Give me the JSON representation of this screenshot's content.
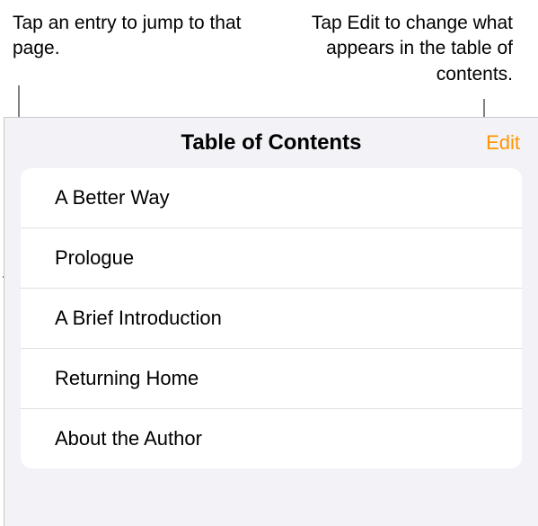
{
  "callouts": {
    "left": "Tap an entry to jump to that page.",
    "right": "Tap Edit to change what appears in the table of contents."
  },
  "panel": {
    "title": "Table of Contents",
    "editLabel": "Edit"
  },
  "toc": {
    "items": [
      {
        "label": "A Better Way"
      },
      {
        "label": "Prologue"
      },
      {
        "label": "A Brief Introduction"
      },
      {
        "label": "Returning Home"
      },
      {
        "label": "About the Author"
      }
    ]
  }
}
